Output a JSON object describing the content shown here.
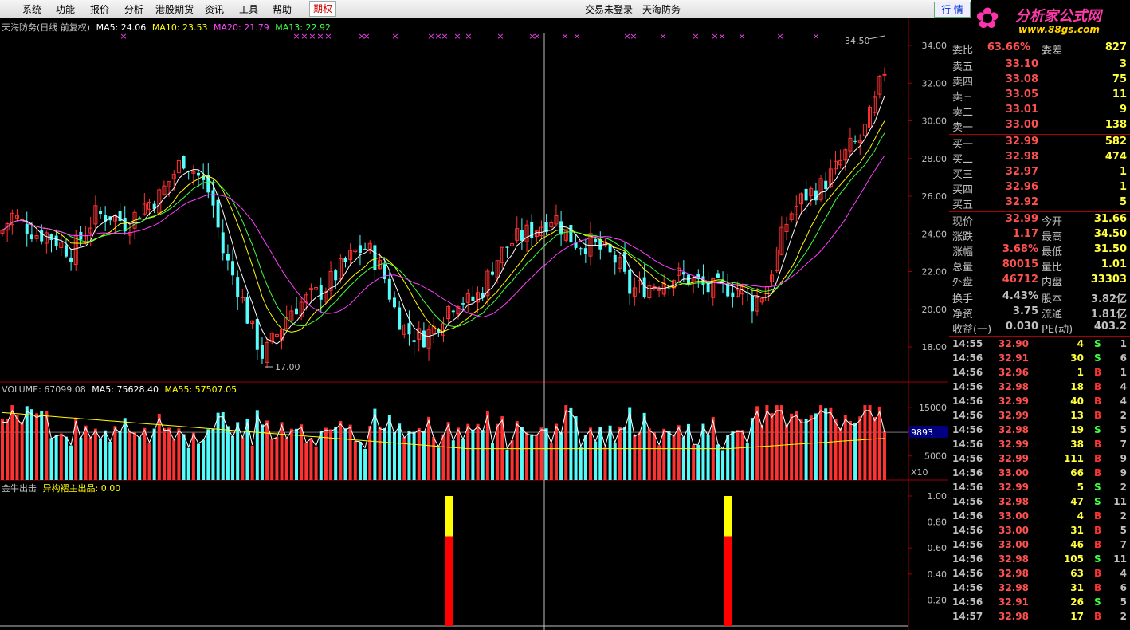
{
  "menu": {
    "items": [
      "系统",
      "功能",
      "报价",
      "分析",
      "港股期货",
      "资讯",
      "工具",
      "帮助",
      "期权"
    ],
    "login": "交易未登录",
    "stock": "天海防务",
    "quote_button": "行 情"
  },
  "logo": {
    "title": "分析家公式网",
    "url": "www.88gs.com"
  },
  "kline": {
    "title": "天海防务(日线 前复权)",
    "ma": [
      {
        "label": "MA5: 24.06",
        "color": "#ffffff"
      },
      {
        "label": "MA10: 23.53",
        "color": "#ffff00"
      },
      {
        "label": "MA20: 21.79",
        "color": "#ff40ff"
      },
      {
        "label": "MA13: 22.92",
        "color": "#40ff40"
      }
    ],
    "y_ticks": [
      "34.00",
      "32.00",
      "30.00",
      "28.00",
      "26.00",
      "24.00",
      "22.00",
      "20.00",
      "18.00"
    ],
    "high_label": "34.50",
    "low_label": "17.00"
  },
  "volume": {
    "legend": [
      {
        "label": "VOLUME: 67099.08",
        "color": "#c0c0c0"
      },
      {
        "label": "MA5: 75628.40",
        "color": "#ffffff"
      },
      {
        "label": "MA55: 57507.05",
        "color": "#ffff00"
      }
    ],
    "y_ticks": [
      "15000",
      "10000",
      "5000"
    ],
    "current": "9893",
    "unit": "X10"
  },
  "indicator": {
    "name": "金牛出击",
    "legend": "异构褶主出品: 0.00",
    "y_ticks": [
      "1.00",
      "0.80",
      "0.60",
      "0.40",
      "0.20"
    ]
  },
  "quote": {
    "header": {
      "label": "委比",
      "value": "63.66%",
      "label2": "委差",
      "value2": "827"
    },
    "asks": [
      {
        "label": "卖五",
        "price": "33.10",
        "vol": "3"
      },
      {
        "label": "卖四",
        "price": "33.08",
        "vol": "75"
      },
      {
        "label": "卖三",
        "price": "33.05",
        "vol": "11"
      },
      {
        "label": "卖二",
        "price": "33.01",
        "vol": "9"
      },
      {
        "label": "卖一",
        "price": "33.00",
        "vol": "138"
      }
    ],
    "bids": [
      {
        "label": "买一",
        "price": "32.99",
        "vol": "582"
      },
      {
        "label": "买二",
        "price": "32.98",
        "vol": "474"
      },
      {
        "label": "买三",
        "price": "32.97",
        "vol": "1"
      },
      {
        "label": "买四",
        "price": "32.96",
        "vol": "1"
      },
      {
        "label": "买五",
        "price": "32.92",
        "vol": "5"
      }
    ],
    "stats": [
      {
        "l1": "现价",
        "v1": "32.99",
        "l2": "今开",
        "v2": "31.66"
      },
      {
        "l1": "涨跌",
        "v1": "1.17",
        "l2": "最高",
        "v2": "34.50"
      },
      {
        "l1": "涨幅",
        "v1": "3.68%",
        "l2": "最低",
        "v2": "31.50"
      },
      {
        "l1": "总量",
        "v1": "80015",
        "l2": "量比",
        "v2": "1.01"
      },
      {
        "l1": "外盘",
        "v1": "46712",
        "l2": "内盘",
        "v2": "33303"
      }
    ],
    "stats2": [
      {
        "l1": "换手",
        "v1": "4.43%",
        "l2": "股本",
        "v2": "3.82亿"
      },
      {
        "l1": "净资",
        "v1": "3.75",
        "l2": "流通",
        "v2": "1.81亿"
      },
      {
        "l1": "收益(一)",
        "v1": "0.030",
        "l2": "PE(动)",
        "v2": "403.2"
      }
    ]
  },
  "ticks": [
    {
      "t": "14:55",
      "p": "32.90",
      "v": "4",
      "bs": "S",
      "n": "1"
    },
    {
      "t": "14:56",
      "p": "32.91",
      "v": "30",
      "bs": "S",
      "n": "6"
    },
    {
      "t": "14:56",
      "p": "32.96",
      "v": "1",
      "bs": "B",
      "n": "1"
    },
    {
      "t": "14:56",
      "p": "32.98",
      "v": "18",
      "bs": "B",
      "n": "4"
    },
    {
      "t": "14:56",
      "p": "32.99",
      "v": "40",
      "bs": "B",
      "n": "4"
    },
    {
      "t": "14:56",
      "p": "32.99",
      "v": "13",
      "bs": "B",
      "n": "2"
    },
    {
      "t": "14:56",
      "p": "32.98",
      "v": "19",
      "bs": "S",
      "n": "5"
    },
    {
      "t": "14:56",
      "p": "32.99",
      "v": "38",
      "bs": "B",
      "n": "7"
    },
    {
      "t": "14:56",
      "p": "32.99",
      "v": "111",
      "bs": "B",
      "n": "9"
    },
    {
      "t": "14:56",
      "p": "33.00",
      "v": "66",
      "bs": "B",
      "n": "9"
    },
    {
      "t": "14:56",
      "p": "32.99",
      "v": "5",
      "bs": "S",
      "n": "2"
    },
    {
      "t": "14:56",
      "p": "32.98",
      "v": "47",
      "bs": "S",
      "n": "11"
    },
    {
      "t": "14:56",
      "p": "33.00",
      "v": "4",
      "bs": "B",
      "n": "2"
    },
    {
      "t": "14:56",
      "p": "33.00",
      "v": "31",
      "bs": "B",
      "n": "5"
    },
    {
      "t": "14:56",
      "p": "33.00",
      "v": "46",
      "bs": "B",
      "n": "7"
    },
    {
      "t": "14:56",
      "p": "32.98",
      "v": "105",
      "bs": "S",
      "n": "11"
    },
    {
      "t": "14:56",
      "p": "32.98",
      "v": "63",
      "bs": "B",
      "n": "4"
    },
    {
      "t": "14:56",
      "p": "32.98",
      "v": "31",
      "bs": "B",
      "n": "6"
    },
    {
      "t": "14:56",
      "p": "32.91",
      "v": "26",
      "bs": "S",
      "n": "5"
    },
    {
      "t": "14:57",
      "p": "32.98",
      "v": "17",
      "bs": "B",
      "n": "2"
    }
  ],
  "colors": {
    "up": "#ff3232",
    "down": "#54fcfc",
    "ma5": "#ffffff",
    "ma10": "#ffff00",
    "ma20": "#ff40ff",
    "ma13": "#40ff40",
    "grid": "#a00000",
    "buy": "#ff3232",
    "sell": "#40ff40"
  }
}
